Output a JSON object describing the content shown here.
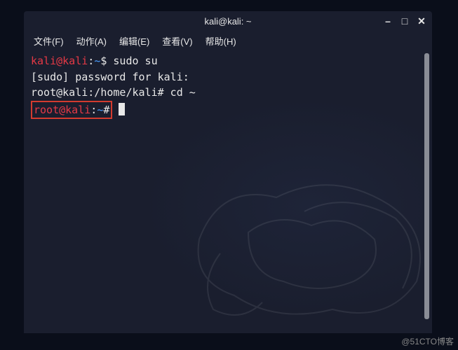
{
  "window": {
    "title": "kali@kali: ~"
  },
  "menu": {
    "file": "文件(F)",
    "action": "动作(A)",
    "edit": "编辑(E)",
    "view": "查看(V)",
    "help": "帮助(H)"
  },
  "terminal": {
    "line1": {
      "user": "kali@kali",
      "sep": ":",
      "path": "~",
      "prompt": "$",
      "cmd": " sudo su"
    },
    "line2": "[sudo] password for kali:",
    "line3": {
      "prefix": "root@kali:/home/kali#",
      "cmd": " cd ~"
    },
    "line4": {
      "user": "root@kali",
      "sep": ":",
      "path": "~",
      "prompt": "#"
    }
  },
  "watermark": "@51CTO博客"
}
